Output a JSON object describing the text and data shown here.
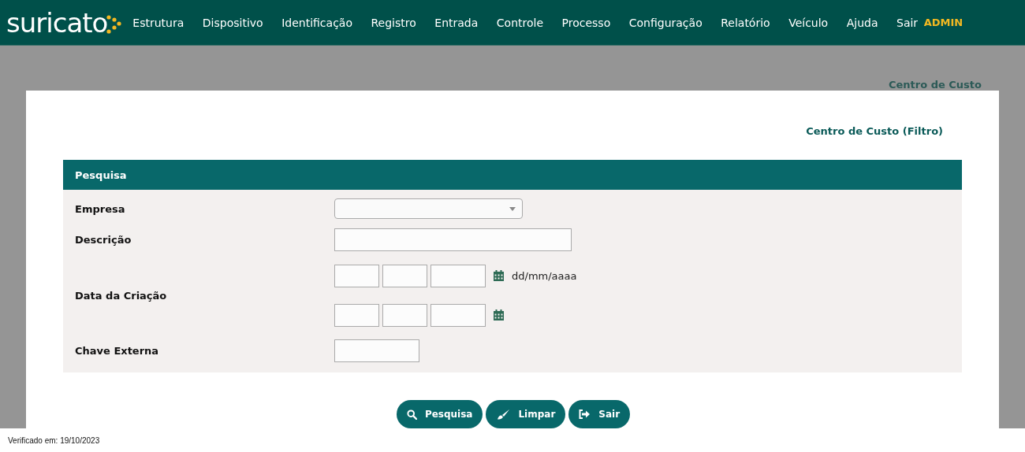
{
  "logo": {
    "text": "suricato"
  },
  "nav": {
    "items": [
      "Estrutura",
      "Dispositivo",
      "Identificação",
      "Registro",
      "Entrada",
      "Controle",
      "Processo",
      "Configuração",
      "Relatório",
      "Veículo",
      "Ajuda",
      "Sair"
    ],
    "user": "ADMIN"
  },
  "breadcrumb": "Centro de Custo",
  "page_title": "Centro de Custo (Filtro)",
  "panel": {
    "title": "Pesquisa",
    "fields": [
      {
        "label": "Empresa",
        "kind": "select"
      },
      {
        "label": "Descrição",
        "kind": "text"
      },
      {
        "label": "Data da Criação",
        "kind": "daterange",
        "hint": "dd/mm/aaaa"
      },
      {
        "label": "Chave Externa",
        "kind": "short"
      }
    ]
  },
  "buttons": [
    {
      "label": "Pesquisa",
      "kind": "search"
    },
    {
      "label": "Limpar",
      "kind": "clear"
    },
    {
      "label": "Sair",
      "kind": "exit"
    }
  ],
  "footer": "Verificado em: 19/10/2023"
}
